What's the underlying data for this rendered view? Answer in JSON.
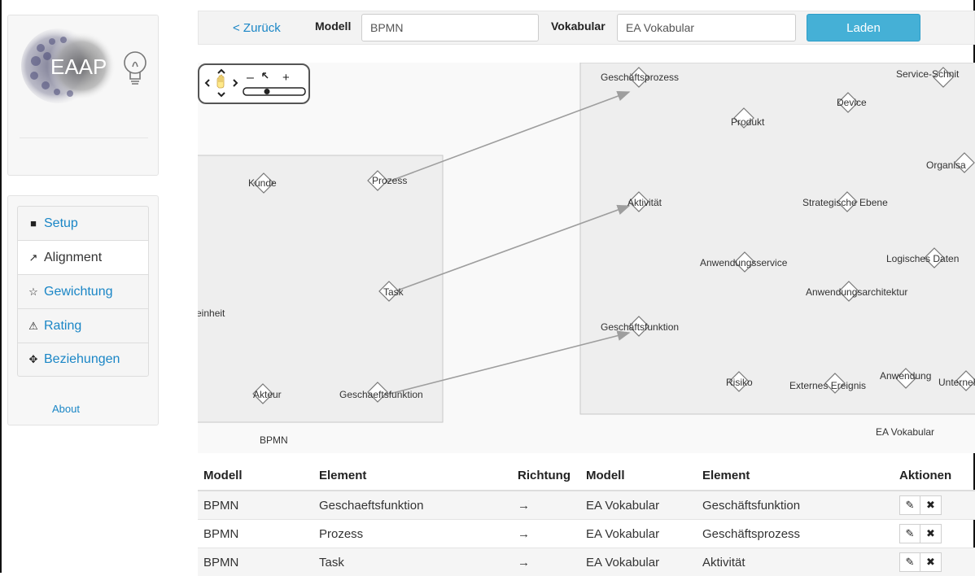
{
  "logo": {
    "text": "EAAP"
  },
  "sidebar": {
    "items": [
      {
        "label": "Setup",
        "icon": "grid-icon",
        "active": false
      },
      {
        "label": "Alignment",
        "icon": "link-icon",
        "active": true
      },
      {
        "label": "Gewichtung",
        "icon": "star-icon",
        "active": false
      },
      {
        "label": "Rating",
        "icon": "warning-icon",
        "active": false
      },
      {
        "label": "Beziehungen",
        "icon": "move-icon",
        "active": false
      }
    ],
    "about": "About"
  },
  "toolbar": {
    "back_label": "< Zurück",
    "model_label": "Modell",
    "model_value": "BPMN",
    "vocab_label": "Vokabular",
    "vocab_value": "EA Vokabular",
    "load_label": "Laden"
  },
  "graph": {
    "left_box_label": "BPMN",
    "right_box_label": "EA Vokabular",
    "left_nodes": [
      "Kunde",
      "Prozess",
      "Task",
      "einheit",
      "Akteur",
      "Geschaeftsfunktion"
    ],
    "right_nodes": [
      "Geschäftsprozess",
      "Service-Schnit",
      "Device",
      "Produkt",
      "Organisa",
      "Aktivität",
      "Strategische Ebene",
      "Anwendungsservice",
      "Logisches Daten",
      "Anwendungsarchitektur",
      "Geschäftsfunktion",
      "Risiko",
      "Externes Ereignis",
      "Anwendung",
      "Unterneh"
    ]
  },
  "table": {
    "headers": [
      "Modell",
      "Element",
      "Richtung",
      "Modell",
      "Element",
      "Aktionen"
    ],
    "rows": [
      {
        "model_a": "BPMN",
        "element_a": "Geschaeftsfunktion",
        "direction": "→",
        "model_b": "EA Vokabular",
        "element_b": "Geschäftsfunktion"
      },
      {
        "model_a": "BPMN",
        "element_a": "Prozess",
        "direction": "→",
        "model_b": "EA Vokabular",
        "element_b": "Geschäftsprozess"
      },
      {
        "model_a": "BPMN",
        "element_a": "Task",
        "direction": "→",
        "model_b": "EA Vokabular",
        "element_b": "Aktivität"
      }
    ]
  },
  "colors": {
    "accent": "#1a86c6",
    "button": "#45b0d6"
  }
}
